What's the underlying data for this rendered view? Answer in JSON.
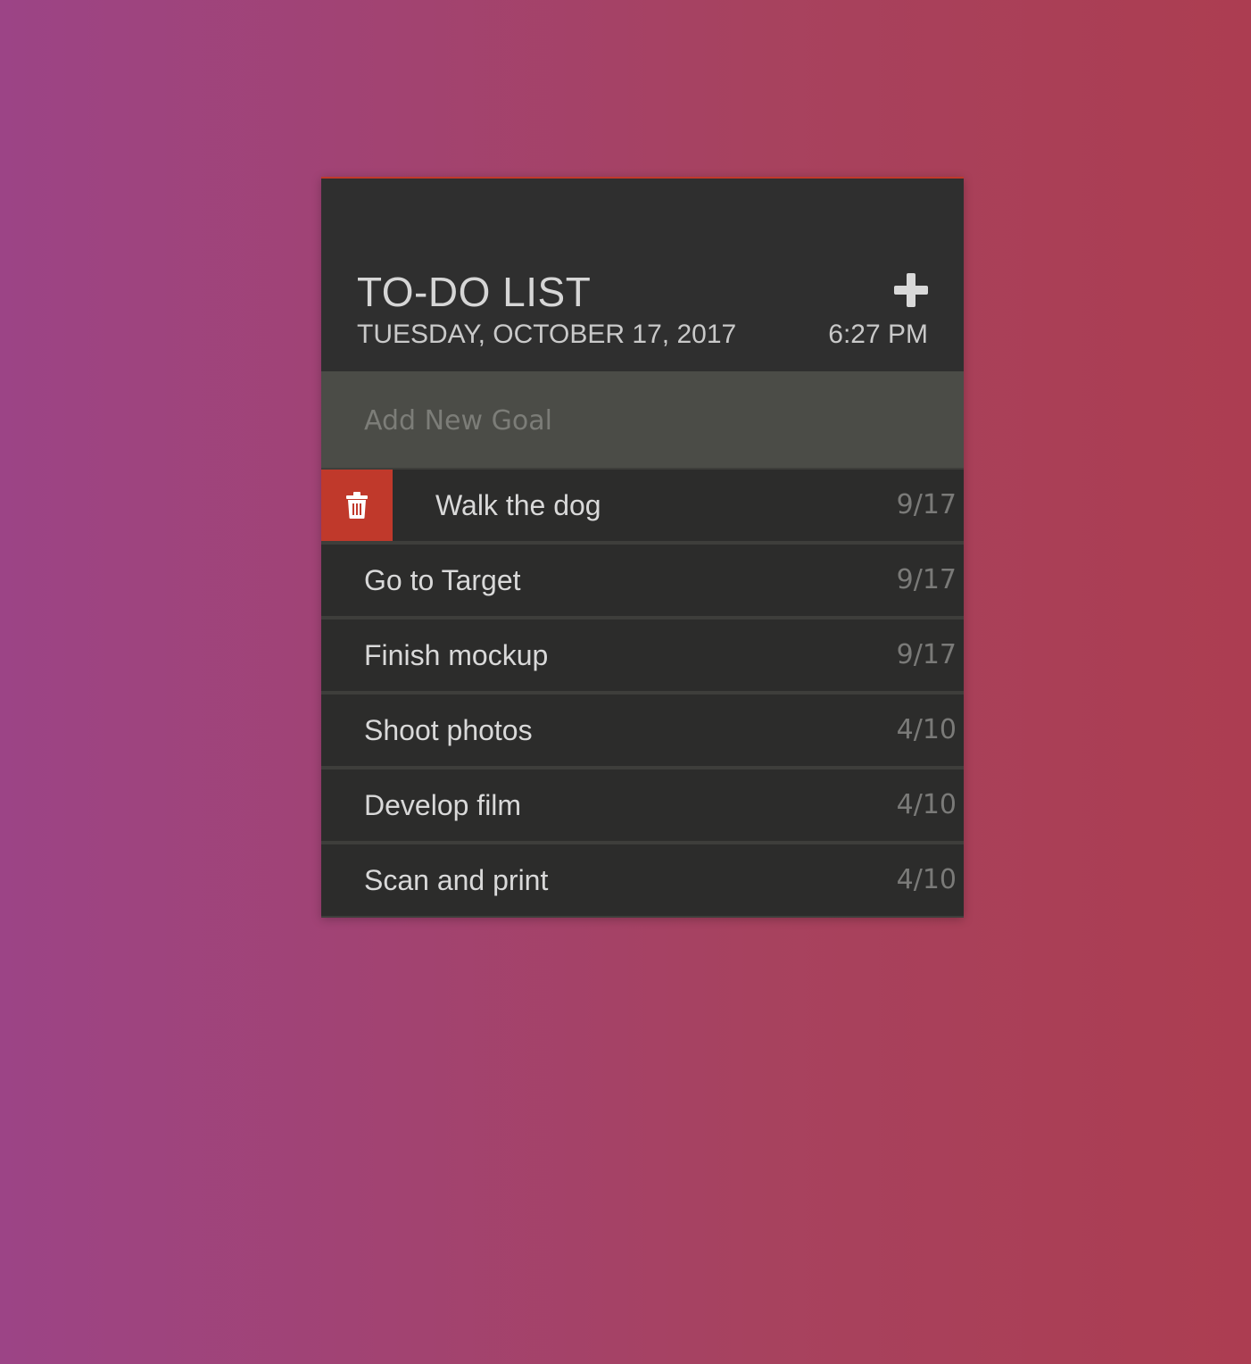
{
  "header": {
    "title": "TO-DO LIST",
    "date": "TUESDAY, OCTOBER 17, 2017",
    "time": "6:27 PM",
    "add_icon": "plus-icon"
  },
  "new_goal": {
    "placeholder": "Add New Goal",
    "value": ""
  },
  "items": [
    {
      "text": "Walk the dog",
      "date": "9/17",
      "delete_revealed": true,
      "delete_icon": "trash-icon"
    },
    {
      "text": "Go to Target",
      "date": "9/17"
    },
    {
      "text": "Finish mockup",
      "date": "9/17"
    },
    {
      "text": "Shoot photos",
      "date": "4/10"
    },
    {
      "text": "Develop film",
      "date": "4/10"
    },
    {
      "text": "Scan and print",
      "date": "4/10"
    }
  ],
  "colors": {
    "accent": "#c0392b",
    "card_background": "#2c2c2b",
    "input_background": "#4b4c47",
    "gradient_left": "#9c4486",
    "gradient_right": "#ac3d51"
  }
}
